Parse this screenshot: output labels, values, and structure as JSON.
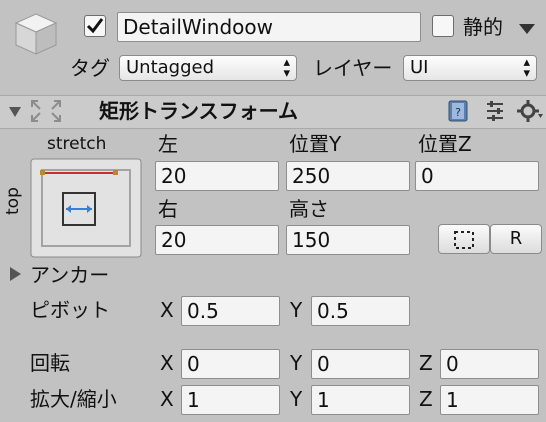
{
  "object": {
    "name": "DetailWindoow",
    "active": true,
    "static_label": "静的",
    "static_checked": false,
    "tag_label": "タグ",
    "tag_value": "Untagged",
    "layer_label": "レイヤー",
    "layer_value": "UI"
  },
  "rect_transform": {
    "title": "矩形トランスフォーム",
    "anchor_preset": {
      "horizontal": "stretch",
      "vertical": "top"
    },
    "col_headers": [
      "左",
      "位置Y",
      "位置Z"
    ],
    "row1_values": [
      "20",
      "250",
      "0"
    ],
    "col_headers2": [
      "右",
      "高さ"
    ],
    "row2_values": [
      "20",
      "150"
    ],
    "blueprint_icon": "dotted-square-icon",
    "raw_button": "R",
    "anchors_label": "アンカー",
    "pivot": {
      "label": "ピボット",
      "x_label": "X",
      "x": "0.5",
      "y_label": "Y",
      "y": "0.5"
    },
    "rotation": {
      "label": "回転",
      "x_label": "X",
      "x": "0",
      "y_label": "Y",
      "y": "0",
      "z_label": "Z",
      "z": "0"
    },
    "scale": {
      "label": "拡大/縮小",
      "x_label": "X",
      "x": "1",
      "y_label": "Y",
      "y": "1",
      "z_label": "Z",
      "z": "1"
    }
  },
  "colors": {
    "anchor_red": "#cc2e2e",
    "arrow_blue": "#3b7dd8",
    "anchor_orange": "#b8892e"
  }
}
